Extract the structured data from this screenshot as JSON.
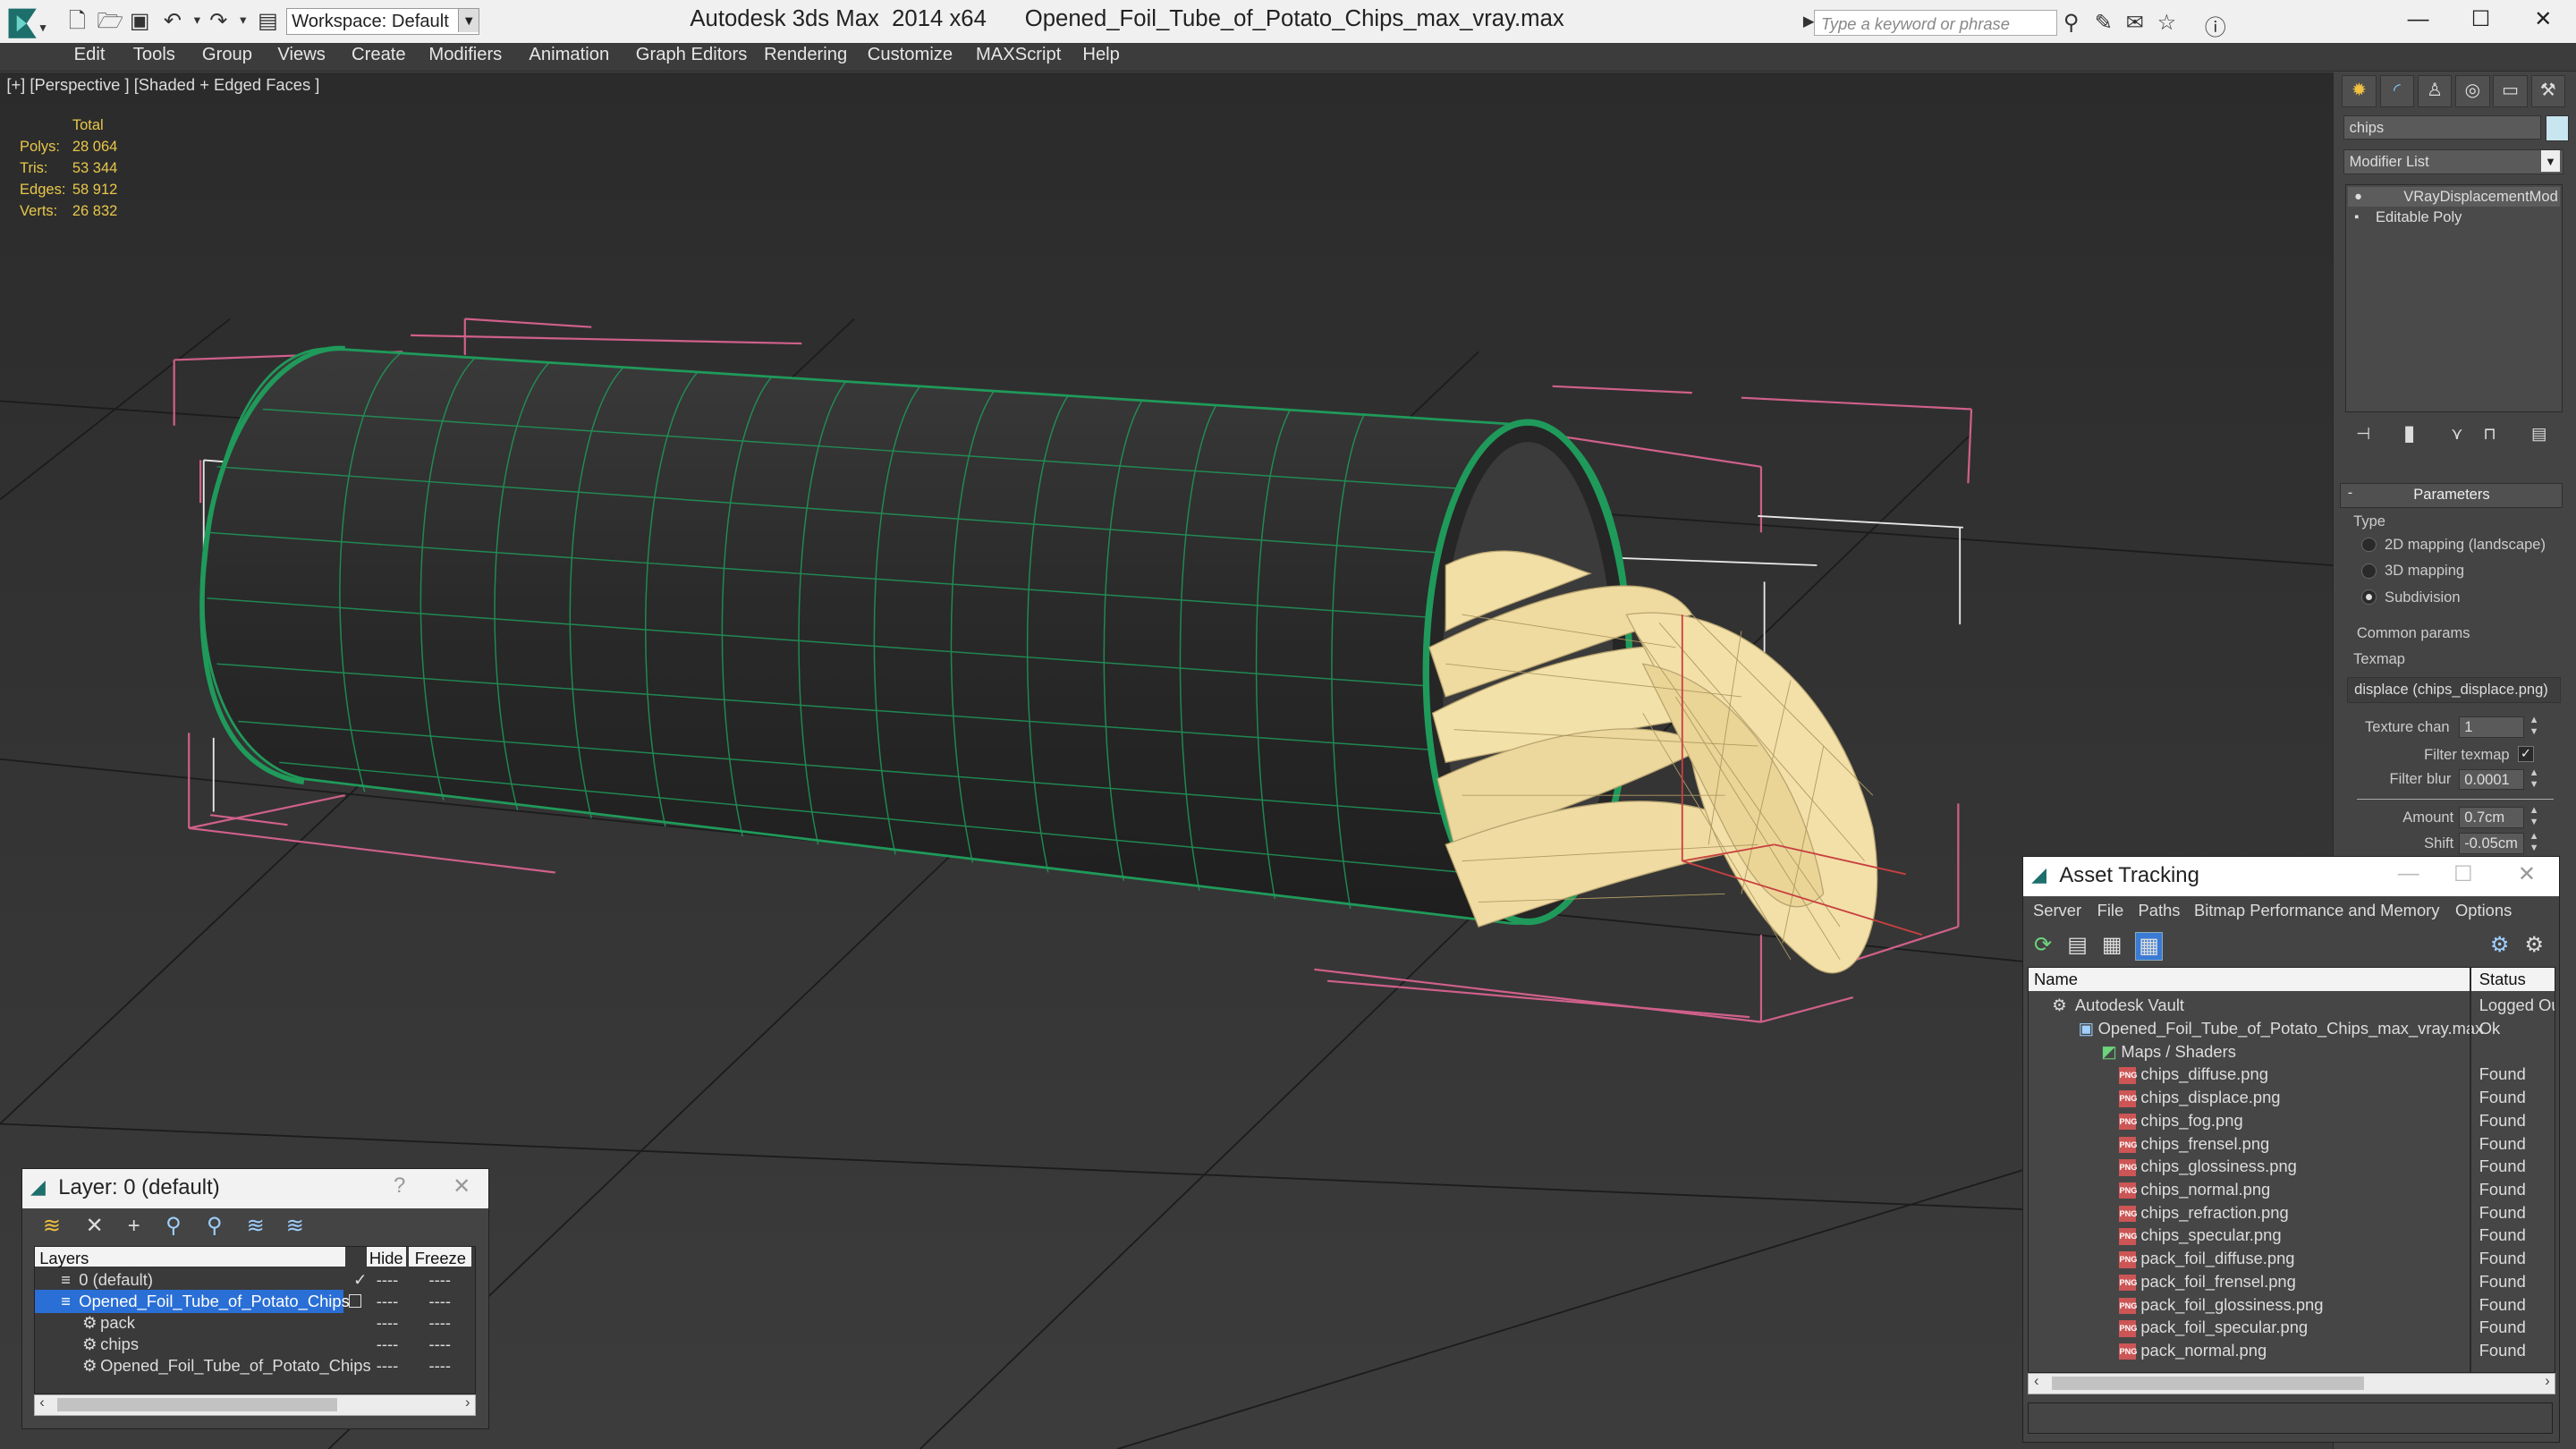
{
  "app": {
    "title_product": "Autodesk 3ds Max  2014 x64",
    "title_file": "Opened_Foil_Tube_of_Potato_Chips_max_vray.max",
    "workspace_label": "Workspace: Default",
    "search_placeholder": "Type a keyword or phrase"
  },
  "menu": [
    "Edit",
    "Tools",
    "Group",
    "Views",
    "Create",
    "Modifiers",
    "Animation",
    "Graph Editors",
    "Rendering",
    "Customize",
    "MAXScript",
    "Help"
  ],
  "viewport": {
    "label": "[+] [Perspective ] [Shaded + Edged Faces ]",
    "stats_header": "Total",
    "stats": [
      {
        "key": "Polys:",
        "value": "28 064"
      },
      {
        "key": "Tris:",
        "value": "53 344"
      },
      {
        "key": "Edges:",
        "value": "58 912"
      },
      {
        "key": "Verts:",
        "value": "26 832"
      }
    ]
  },
  "command_panel": {
    "object_name": "chips",
    "modifier_list": "Modifier List",
    "stack": [
      "VRayDisplacementMod",
      "Editable Poly"
    ],
    "rollout_title": "Parameters",
    "type_label": "Type",
    "type_options": [
      "2D mapping (landscape)",
      "3D mapping",
      "Subdivision"
    ],
    "type_selected": "Subdivision",
    "common_params": "Common params",
    "texmap_label": "Texmap",
    "texmap_value": "displace (chips_displace.png)",
    "texture_chan_label": "Texture chan",
    "texture_chan_value": "1",
    "filter_texmap_label": "Filter texmap",
    "filter_texmap_checked": true,
    "filter_blur_label": "Filter blur",
    "filter_blur_value": "0.0001",
    "amount_label": "Amount",
    "amount_value": "0.7cm",
    "shift_label": "Shift",
    "shift_value": "-0.05cm"
  },
  "layer_window": {
    "title": "Layer: 0 (default)",
    "columns": [
      "Layers",
      "Hide",
      "Freeze"
    ],
    "rows": [
      {
        "name": "0 (default)",
        "selected": false,
        "hide": "----",
        "freeze": "----"
      },
      {
        "name": "Opened_Foil_Tube_of_Potato_Chips",
        "selected": true,
        "hide": "----",
        "freeze": "----"
      },
      {
        "name": "pack",
        "selected": false,
        "hide": "----",
        "freeze": "----"
      },
      {
        "name": "chips",
        "selected": false,
        "hide": "----",
        "freeze": "----"
      },
      {
        "name": "Opened_Foil_Tube_of_Potato_Chips",
        "selected": false,
        "hide": "----",
        "freeze": "----"
      }
    ]
  },
  "asset_window": {
    "title": "Asset Tracking",
    "menu": [
      "Server",
      "File",
      "Paths",
      "Bitmap Performance and Memory",
      "Options"
    ],
    "columns": [
      "Name",
      "Status"
    ],
    "vault": {
      "name": "Autodesk Vault",
      "status": "Logged Out"
    },
    "file": {
      "name": "Opened_Foil_Tube_of_Potato_Chips_max_vray.max",
      "status": "Ok"
    },
    "group": "Maps / Shaders",
    "maps": [
      {
        "name": "chips_diffuse.png",
        "status": "Found"
      },
      {
        "name": "chips_displace.png",
        "status": "Found"
      },
      {
        "name": "chips_fog.png",
        "status": "Found"
      },
      {
        "name": "chips_frensel.png",
        "status": "Found"
      },
      {
        "name": "chips_glossiness.png",
        "status": "Found"
      },
      {
        "name": "chips_normal.png",
        "status": "Found"
      },
      {
        "name": "chips_refraction.png",
        "status": "Found"
      },
      {
        "name": "chips_specular.png",
        "status": "Found"
      },
      {
        "name": "pack_foil_diffuse.png",
        "status": "Found"
      },
      {
        "name": "pack_foil_frensel.png",
        "status": "Found"
      },
      {
        "name": "pack_foil_glossiness.png",
        "status": "Found"
      },
      {
        "name": "pack_foil_specular.png",
        "status": "Found"
      },
      {
        "name": "pack_normal.png",
        "status": "Found"
      }
    ]
  },
  "colors": {
    "wire_green": "#1f9a5a",
    "bbox_pink": "#d0608a",
    "chips": "#f0dca0",
    "stats_yellow": "#e8c74a",
    "selection_blue": "#2a6fd6"
  }
}
